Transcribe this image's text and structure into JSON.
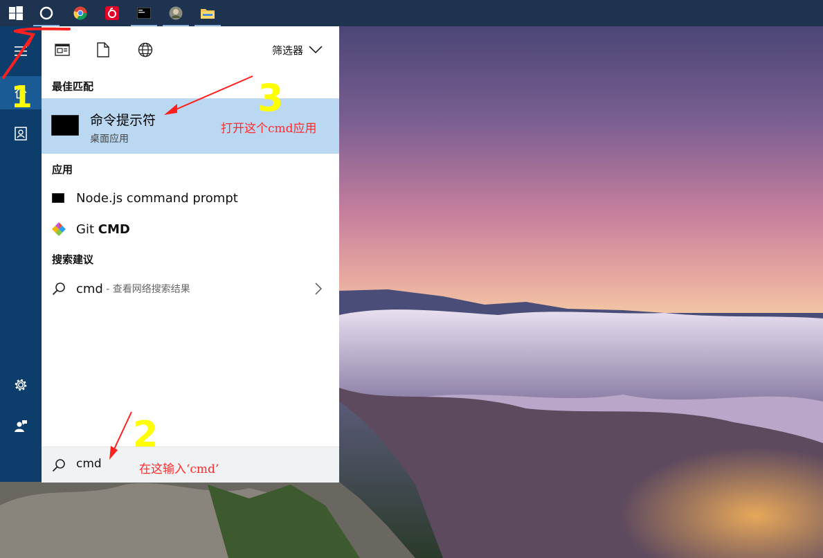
{
  "filter_bar": {
    "filter_label": "筛选器"
  },
  "best_match": {
    "section_title": "最佳匹配",
    "name": "命令提示符",
    "type": "桌面应用"
  },
  "apps": {
    "section_title": "应用",
    "items": [
      {
        "label": "Node.js command prompt"
      },
      {
        "label_prefix": "Git ",
        "label_bold": "CMD"
      }
    ]
  },
  "suggestions": {
    "section_title": "搜索建议",
    "query": "cmd",
    "hint": " - 查看网络搜索结果"
  },
  "search": {
    "value": "cmd"
  },
  "annotations": {
    "step1": "1",
    "step2": "2",
    "step3": "3",
    "note_open": "打开这个cmd应用",
    "note_input": "在这输入‘cmd’"
  },
  "colors": {
    "taskbar": "#1d3350",
    "rail": "#0c3d6b",
    "highlight": "#bad8f2",
    "annotation_red": "#ff2a2a",
    "annotation_yellow": "#ffff00"
  },
  "taskbar_apps": [
    "windows-logo-icon",
    "cortana-icon",
    "chrome-icon",
    "netease-music-icon",
    "terminal-icon",
    "photo-app-icon",
    "file-explorer-icon"
  ]
}
